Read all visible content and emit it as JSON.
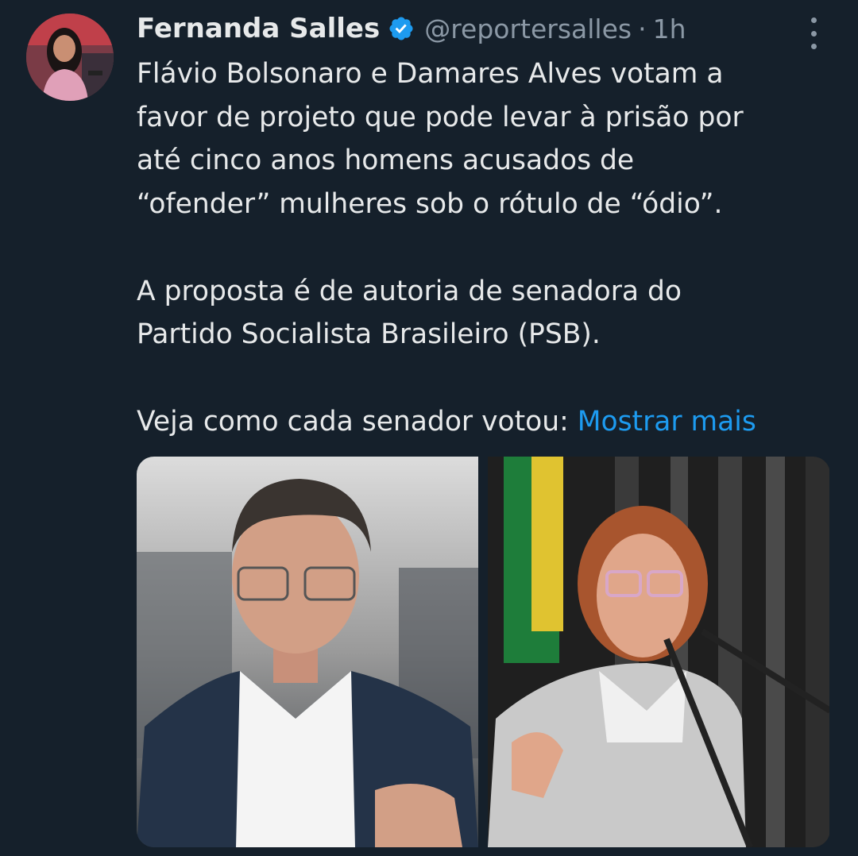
{
  "author": {
    "display_name": "Fernanda Salles",
    "handle": "@reportersalles",
    "separator": "·",
    "time": "1h",
    "avatar_icon": "avatar-photo",
    "verified_icon": "verified-badge-icon",
    "verified_color": "#1d9bf0"
  },
  "menu": {
    "icon": "more-options-icon"
  },
  "tweet": {
    "lines": [
      "Flávio Bolsonaro e Damares Alves votam a",
      "favor de projeto que pode levar à prisão por",
      "até cinco anos homens acusados de",
      "“ofender” mulheres sob o rótulo de “ódio”.",
      "",
      "A proposta é de autoria de senadora do",
      "Partido Socialista Brasileiro (PSB).",
      "",
      "Veja como cada senador votou: "
    ],
    "show_more": "Mostrar mais"
  },
  "media": {
    "photos": [
      "photo-man-senator",
      "photo-woman-senator"
    ]
  },
  "colors": {
    "background": "#15202b",
    "text": "#e7e9ea",
    "secondary": "#8b98a5",
    "link": "#1d9bf0"
  }
}
